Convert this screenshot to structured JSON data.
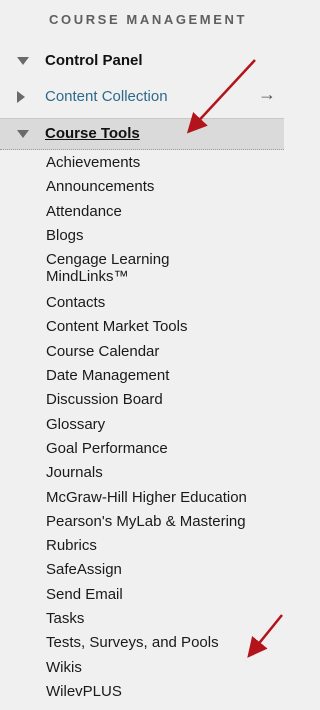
{
  "section": {
    "title": "COURSE MANAGEMENT"
  },
  "control_panel": {
    "label": "Control Panel"
  },
  "content_collection": {
    "label": "Content Collection",
    "arrow": "→"
  },
  "course_tools": {
    "label": "Course Tools",
    "items": [
      "Achievements",
      "Announcements",
      "Attendance",
      "Blogs",
      "Cengage Learning MindLinks™",
      "Contacts",
      "Content Market Tools",
      "Course Calendar",
      "Date Management",
      "Discussion Board",
      "Glossary",
      "Goal Performance",
      "Journals",
      "McGraw-Hill Higher Education",
      "Pearson's MyLab & Mastering",
      "Rubrics",
      "SafeAssign",
      "Send Email",
      "Tasks",
      "Tests, Surveys, and Pools",
      "Wikis",
      "WilevPLUS"
    ]
  },
  "colors": {
    "annotation_arrow": "#b3141b",
    "link": "#2b6b8a",
    "background": "#f0f0f0"
  }
}
